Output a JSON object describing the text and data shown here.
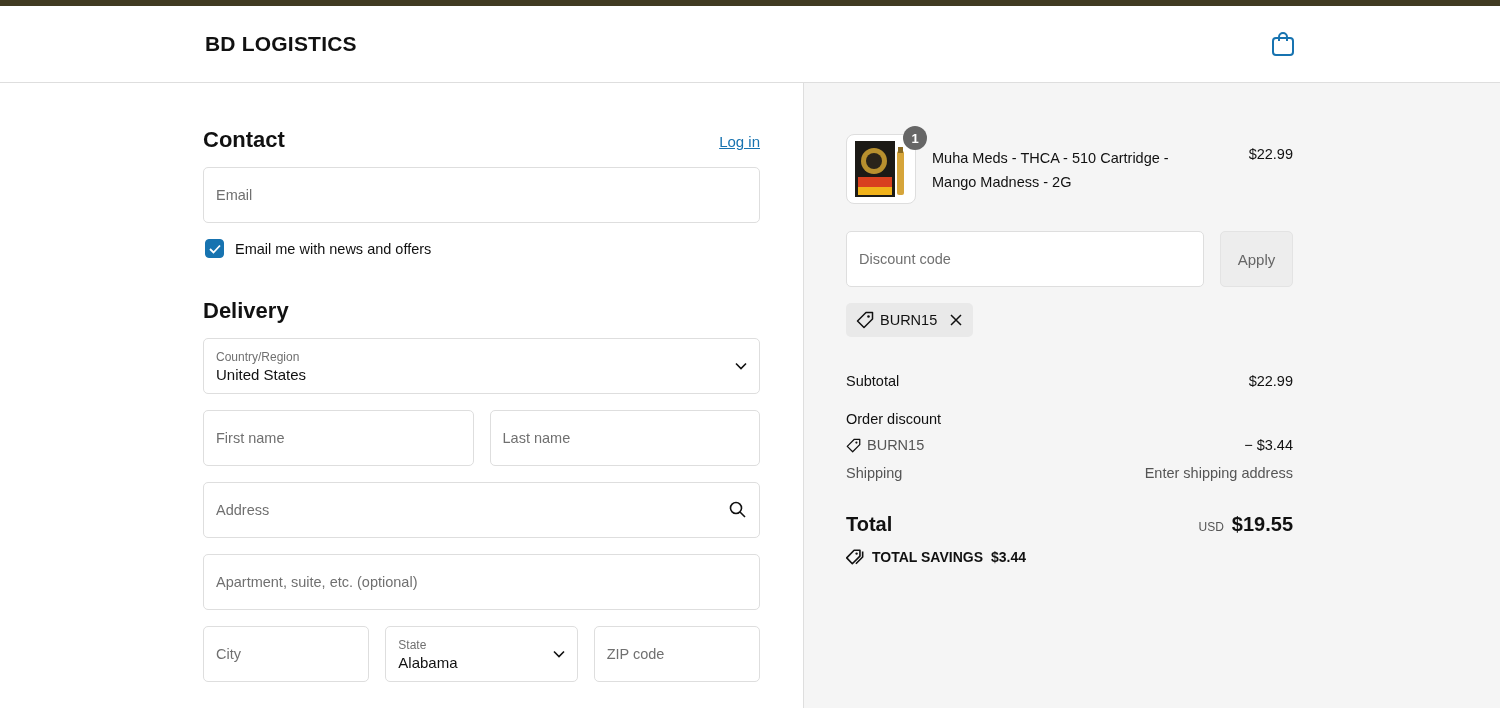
{
  "header": {
    "logo": "BD LOGISTICS"
  },
  "contact": {
    "title": "Contact",
    "login": "Log in",
    "email": {
      "placeholder": "Email"
    },
    "newsletter": {
      "label": "Email me with news and offers",
      "checked": true
    }
  },
  "delivery": {
    "title": "Delivery",
    "rows": [
      [
        {
          "kind": "select",
          "label": "Country/Region",
          "value": "United States"
        }
      ],
      [
        {
          "kind": "text",
          "placeholder": "First name"
        },
        {
          "kind": "text",
          "placeholder": "Last name"
        }
      ],
      [
        {
          "kind": "search",
          "placeholder": "Address"
        }
      ],
      [
        {
          "kind": "text",
          "placeholder": "Apartment, suite, etc. (optional)"
        }
      ],
      [
        {
          "kind": "text",
          "placeholder": "City"
        },
        {
          "kind": "select",
          "label": "State",
          "value": "Alabama"
        },
        {
          "kind": "text",
          "placeholder": "ZIP code"
        }
      ]
    ]
  },
  "summary": {
    "items": [
      {
        "quantity": "1",
        "name": "Muha Meds - THCA - 510 Cartridge - Mango Madness - 2G",
        "price": "$22.99"
      }
    ],
    "discount": {
      "placeholder": "Discount code",
      "button": "Apply"
    },
    "applied_codes": [
      "BURN15"
    ],
    "lines": [
      {
        "kind": "plain",
        "label": "Subtotal",
        "value": "$22.99"
      },
      {
        "kind": "heading",
        "label": "Order discount"
      },
      {
        "kind": "code",
        "label": "BURN15",
        "value": "− $3.44"
      },
      {
        "kind": "muted",
        "label": "Shipping",
        "value": "Enter shipping address"
      }
    ],
    "total": {
      "label": "Total",
      "currency": "USD",
      "amount": "$19.55"
    },
    "savings": {
      "label": "TOTAL SAVINGS",
      "amount": "$3.44"
    }
  }
}
